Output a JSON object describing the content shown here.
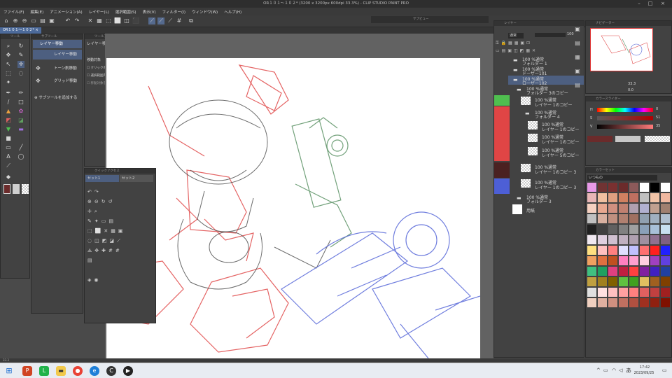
{
  "app": {
    "title": "OR１０１～１０２* (3200 x 3200px 600dpi 33.3%) - CLIP STUDIO PAINT PRO",
    "tab": "OR１０１～１０２*"
  },
  "menu": [
    "ファイル(F)",
    "編集(E)",
    "アニメーション(A)",
    "レイヤー(L)",
    "選択範囲(S)",
    "表示(V)",
    "フィルター(I)",
    "ウィンドウ(W)",
    "ヘルプ(H)"
  ],
  "subview_title": "サブビュー",
  "subtool": {
    "header": "サブツール",
    "items": [
      "レイヤー移動",
      "レイヤー移動",
      "トーン削移動",
      "グリッド移動"
    ],
    "add_label": "サブツールを追加する"
  },
  "tool_property": {
    "header": "ツールプロパティ",
    "title": "レイヤー移動",
    "target_label": "移動対象",
    "options": [
      "クリックの位置にあるで移動",
      "選択範囲内のレイヤーを移動",
      "移動対象を選択状態にする"
    ]
  },
  "brush_size_header": "ブラシサイズ",
  "quick_access": {
    "header": "クイックアクセス",
    "tabs": [
      "セット1",
      "セット2"
    ]
  },
  "layer_panel": {
    "header": "レイヤー",
    "blend_mode": "通常",
    "opacity": "100",
    "layers": [
      {
        "pct": "100 %通常",
        "name": "フォルダー 1",
        "kind": "folder"
      },
      {
        "pct": "100 %通常",
        "name": "ドーザー101",
        "kind": "folder"
      },
      {
        "pct": "100 %通常",
        "name": "ローザー102",
        "kind": "folder",
        "selected": true
      },
      {
        "pct": "100 %通常",
        "name": "フォルダー 3のコピー",
        "kind": "folder"
      },
      {
        "pct": "100 %通常",
        "name": "レイヤー 1のコピー",
        "kind": "layer"
      },
      {
        "pct": "100 %通常",
        "name": "フォルダー 4",
        "kind": "folder"
      },
      {
        "pct": "100 %通常",
        "name": "レイヤー 1のコピー",
        "kind": "layer"
      },
      {
        "pct": "100 %通常",
        "name": "レイヤー 1のコピー",
        "kind": "layer"
      },
      {
        "pct": "100 %通常",
        "name": "レイヤー 5のコピー",
        "kind": "layer"
      },
      {
        "pct": "100 %通常",
        "name": "レイヤー 1のコピー 3",
        "kind": "layer"
      },
      {
        "pct": "100 %通常",
        "name": "レイヤー 1のコピー 3",
        "kind": "layer"
      },
      {
        "pct": "100 %通常",
        "name": "フォルダー 3",
        "kind": "folder"
      },
      {
        "pct": "",
        "name": "用紙",
        "kind": "paper"
      }
    ]
  },
  "navigator": {
    "header": "ナビゲーター",
    "zoom": "33.3",
    "angle": "0.0"
  },
  "color_slider": {
    "header": "カラースライダー",
    "h_label": "H",
    "h_value": "0",
    "s_label": "S",
    "s_value": "51",
    "v_label": "V",
    "v_value": "35"
  },
  "color_set": {
    "header": "カラーセット",
    "set_name": "いつもの"
  },
  "status": {
    "zoom": "33.3"
  },
  "clock": {
    "time": "17:42",
    "date": "2023/09/25"
  },
  "tray": {
    "ime": "あ"
  },
  "colors": {
    "accent": "#4d5f80",
    "main_color": "#6b2b2b",
    "layer_red": "#e04545",
    "layer_green": "#4fbf4f",
    "layer_blue": "#4d5fd6",
    "layer_dark": "#4a2121"
  },
  "palette": [
    "#e89ae8",
    "#703333",
    "#7a3030",
    "#6b2b2b",
    "#8c5a5a",
    "#ffffff",
    "#000000",
    "#ffffff",
    "#e8b6b6",
    "#f0c0a0",
    "#e0a080",
    "#d08060",
    "#c07060",
    "#c0c0c0",
    "#f2c4a8",
    "#f0b8a0",
    "#f5d0c0",
    "#e8a890",
    "#d09080",
    "#c08070",
    "#b0a0b0",
    "#b0b0d0",
    "#c0a090",
    "#a08070",
    "#c0c0c0",
    "#d8b0a0",
    "#c09080",
    "#b08070",
    "#a07060",
    "#90a0b0",
    "#a0b0c0",
    "#b0c0d0",
    "#202020",
    "#404040",
    "#606060",
    "#808080",
    "#a0a0a0",
    "#8aa0b8",
    "#a8c0d8",
    "#c8e0f0",
    "#f0e8f0",
    "#e0d0e0",
    "#d0c0d0",
    "#c0b0c0",
    "#b0a0b0",
    "#a090a0",
    "#907090",
    "#806080",
    "#ffe080",
    "#ffc0c0",
    "#ff8080",
    "#e0e0ff",
    "#c0c0ff",
    "#ff7070",
    "#ff2020",
    "#2020ff",
    "#f0a060",
    "#e07040",
    "#c05020",
    "#ff80c0",
    "#ffa0d0",
    "#ffd0e0",
    "#a040c0",
    "#6040e0",
    "#40c080",
    "#20a060",
    "#e04080",
    "#c02040",
    "#ff4040",
    "#8020a0",
    "#4020c0",
    "#2040a0",
    "#c0a040",
    "#a08020",
    "#806000",
    "#60c040",
    "#40a020",
    "#e0c060",
    "#a06020",
    "#804000",
    "#e0e0e0",
    "#ffe0e0",
    "#ffc0c0",
    "#ffa0a0",
    "#ff8080",
    "#e06060",
    "#c04040",
    "#a02020",
    "#f0d0c0",
    "#e0b0a0",
    "#d09080",
    "#c07060",
    "#b05040",
    "#a03020",
    "#902010",
    "#801000"
  ]
}
